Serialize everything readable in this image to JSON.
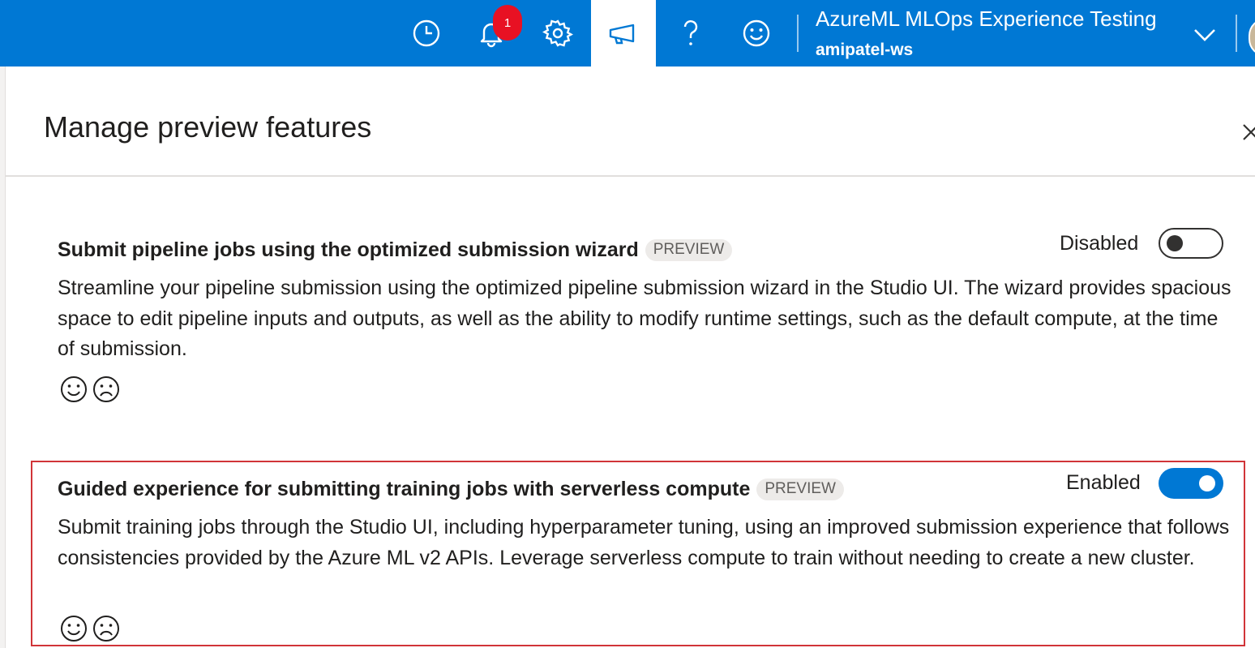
{
  "header": {
    "icons": [
      "clock-icon",
      "bell-icon",
      "gear-icon",
      "megaphone-icon",
      "help-icon",
      "smiley-icon"
    ],
    "notification_count": "1",
    "workspace_title": "AzureML MLOps Experience Testing",
    "workspace_name": "amipatel-ws",
    "colors": {
      "bar": "#0078d4",
      "badge": "#e81123"
    }
  },
  "panel": {
    "title": "Manage preview features",
    "features": [
      {
        "title": "Submit pipeline jobs using the optimized submission wizard",
        "tag": "PREVIEW",
        "description": "Streamline your pipeline submission using the optimized pipeline submission wizard in the Studio UI. The wizard provides spacious space to edit pipeline inputs and outputs, as well as the ability to modify runtime settings, such as the default compute, at the time of submission.",
        "status": "Disabled",
        "enabled": false
      },
      {
        "title": "Guided experience for submitting training jobs with serverless compute",
        "tag": "PREVIEW",
        "description": "Submit training jobs through the Studio UI, including hyperparameter tuning, using an improved submission experience that follows consistencies provided by the Azure ML v2 APIs. Leverage serverless compute to train without needing to create a new cluster.",
        "status": "Enabled",
        "enabled": true
      }
    ]
  }
}
